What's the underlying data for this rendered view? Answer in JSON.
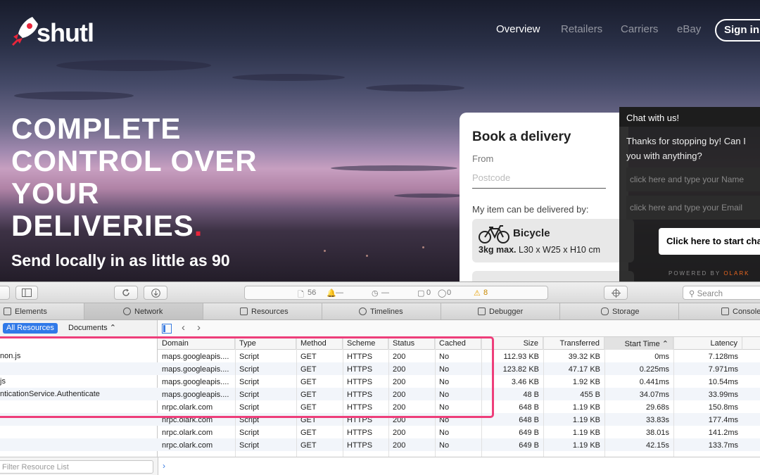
{
  "site": {
    "logo_text": "shutl",
    "nav": [
      "Overview",
      "Retailers",
      "Carriers",
      "eBay"
    ],
    "signin_label": "Sign in",
    "headline": [
      "COMPLETE",
      "CONTROL OVER",
      "YOUR",
      "DELIVERIES"
    ],
    "headline_dot": ".",
    "subline": "Send locally in as little as 90",
    "booking": {
      "title": "Book a delivery",
      "from_label": "From",
      "postcode_placeholder": "Postcode",
      "item_label": "My item can be delivered by:",
      "vehicle_name": "Bicycle",
      "vehicle_spec_bold": "3kg max.",
      "vehicle_spec": " L30 x W25 x H10 cm"
    },
    "chat": {
      "header": "Chat with us!",
      "message": "Thanks for stopping by! Can I you with anything?",
      "name_placeholder": "click here and type your Name",
      "email_placeholder": "click here and type your Email",
      "start_button": "Click here to start cha",
      "powered_by": "POWERED BY ",
      "powered_brand": "OLARK"
    },
    "colors": {
      "accent_red": "#e8253a",
      "highlight": "#ee3e7a",
      "olark": "#e86620"
    }
  },
  "inspector": {
    "activity": {
      "resources": "56",
      "dash1": "—",
      "dash2": "—",
      "errors": "0",
      "logs": "0",
      "warnings": "8"
    },
    "search_placeholder": "Search",
    "tabs": [
      {
        "label": "Elements",
        "icon": "elements-icon"
      },
      {
        "label": "Network",
        "icon": "network-icon"
      },
      {
        "label": "Resources",
        "icon": "resources-icon"
      },
      {
        "label": "Timelines",
        "icon": "timelines-icon"
      },
      {
        "label": "Debugger",
        "icon": "debugger-icon"
      },
      {
        "label": "Storage",
        "icon": "storage-icon"
      },
      {
        "label": "Console",
        "icon": "console-icon"
      }
    ],
    "filter": {
      "all_resources": "All Resources",
      "documents": "Documents"
    },
    "resource_names": [
      "non.js",
      "",
      "js",
      "nticationService.Authenticate",
      "",
      "",
      "",
      ""
    ],
    "columns": [
      "Domain",
      "Type",
      "Method",
      "Scheme",
      "Status",
      "Cached",
      "Size",
      "Transferred",
      "Start Time",
      "Latency"
    ],
    "rows": [
      [
        "maps.googleapis....",
        "Script",
        "GET",
        "HTTPS",
        "200",
        "No",
        "112.93 KB",
        "39.32 KB",
        "0ms",
        "7.128ms"
      ],
      [
        "maps.googleapis....",
        "Script",
        "GET",
        "HTTPS",
        "200",
        "No",
        "123.82 KB",
        "47.17 KB",
        "0.225ms",
        "7.971ms"
      ],
      [
        "maps.googleapis....",
        "Script",
        "GET",
        "HTTPS",
        "200",
        "No",
        "3.46 KB",
        "1.92 KB",
        "0.441ms",
        "10.54ms"
      ],
      [
        "maps.googleapis....",
        "Script",
        "GET",
        "HTTPS",
        "200",
        "No",
        "48 B",
        "455 B",
        "34.07ms",
        "33.99ms"
      ],
      [
        "nrpc.olark.com",
        "Script",
        "GET",
        "HTTPS",
        "200",
        "No",
        "648 B",
        "1.19 KB",
        "29.68s",
        "150.8ms"
      ],
      [
        "nrpc.olark.com",
        "Script",
        "GET",
        "HTTPS",
        "200",
        "No",
        "648 B",
        "1.19 KB",
        "33.83s",
        "177.4ms"
      ],
      [
        "nrpc.olark.com",
        "Script",
        "GET",
        "HTTPS",
        "200",
        "No",
        "649 B",
        "1.19 KB",
        "38.01s",
        "141.2ms"
      ],
      [
        "nrpc.olark.com",
        "Script",
        "GET",
        "HTTPS",
        "200",
        "No",
        "649 B",
        "1.19 KB",
        "42.15s",
        "133.7ms"
      ]
    ],
    "filter_resource_placeholder": "Filter Resource List",
    "console_prompt": "›"
  }
}
